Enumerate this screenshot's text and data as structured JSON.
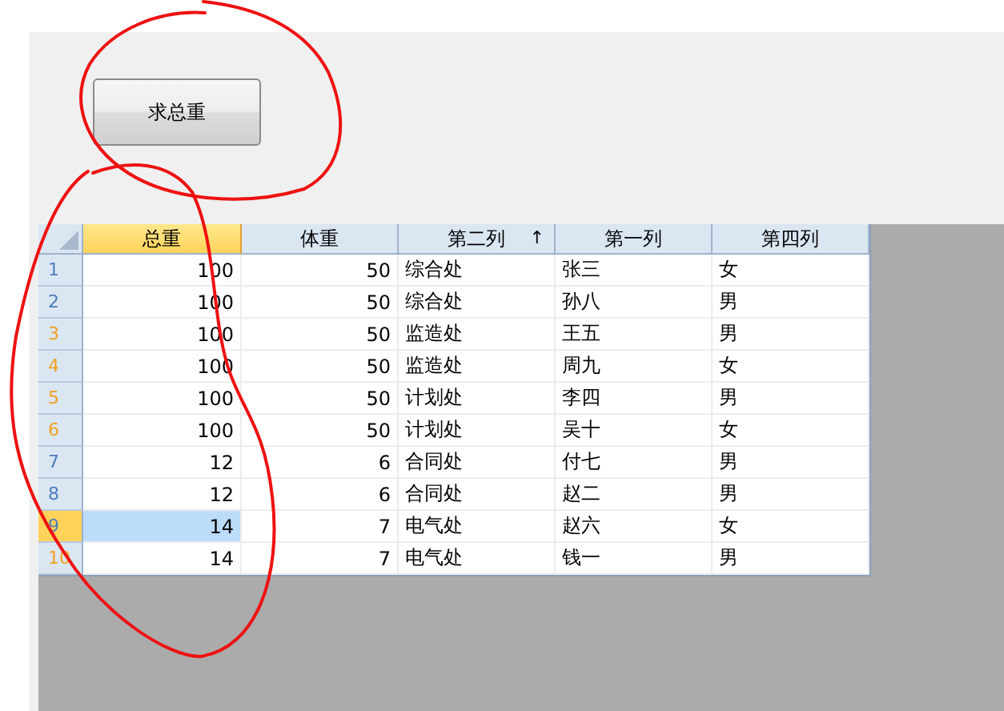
{
  "button": {
    "label": "求总重"
  },
  "table": {
    "columns": [
      {
        "label": "总重",
        "selected": true,
        "kind": "number"
      },
      {
        "label": "体重",
        "selected": false,
        "kind": "number"
      },
      {
        "label": "第二列",
        "selected": false,
        "kind": "text",
        "sort_mark": "↑"
      },
      {
        "label": "第一列",
        "selected": false,
        "kind": "text"
      },
      {
        "label": "第四列",
        "selected": false,
        "kind": "text"
      }
    ],
    "rows": [
      {
        "number": "1",
        "color": "#4a7ebb",
        "selected": false,
        "cells": [
          "100",
          "50",
          "综合处",
          "张三",
          "女"
        ]
      },
      {
        "number": "2",
        "color": "#4a7ebb",
        "selected": false,
        "cells": [
          "100",
          "50",
          "综合处",
          "孙八",
          "男"
        ]
      },
      {
        "number": "3",
        "color": "#f0a020",
        "selected": false,
        "cells": [
          "100",
          "50",
          "监造处",
          "王五",
          "男"
        ]
      },
      {
        "number": "4",
        "color": "#f0a020",
        "selected": false,
        "cells": [
          "100",
          "50",
          "监造处",
          "周九",
          "女"
        ]
      },
      {
        "number": "5",
        "color": "#f0a020",
        "selected": false,
        "cells": [
          "100",
          "50",
          "计划处",
          "李四",
          "男"
        ]
      },
      {
        "number": "6",
        "color": "#f0a020",
        "selected": false,
        "cells": [
          "100",
          "50",
          "计划处",
          "吴十",
          "女"
        ]
      },
      {
        "number": "7",
        "color": "#4a7ebb",
        "selected": false,
        "cells": [
          "12",
          "6",
          "合同处",
          "付七",
          "男"
        ]
      },
      {
        "number": "8",
        "color": "#4a7ebb",
        "selected": false,
        "cells": [
          "12",
          "6",
          "合同处",
          "赵二",
          "男"
        ]
      },
      {
        "number": "9",
        "color": "#4a7ebb",
        "selected": true,
        "cells": [
          "14",
          "7",
          "电气处",
          "赵六",
          "女"
        ]
      },
      {
        "number": "10",
        "color": "#f0a020",
        "selected": false,
        "cells": [
          "14",
          "7",
          "电气处",
          "钱一",
          "男"
        ]
      }
    ]
  }
}
